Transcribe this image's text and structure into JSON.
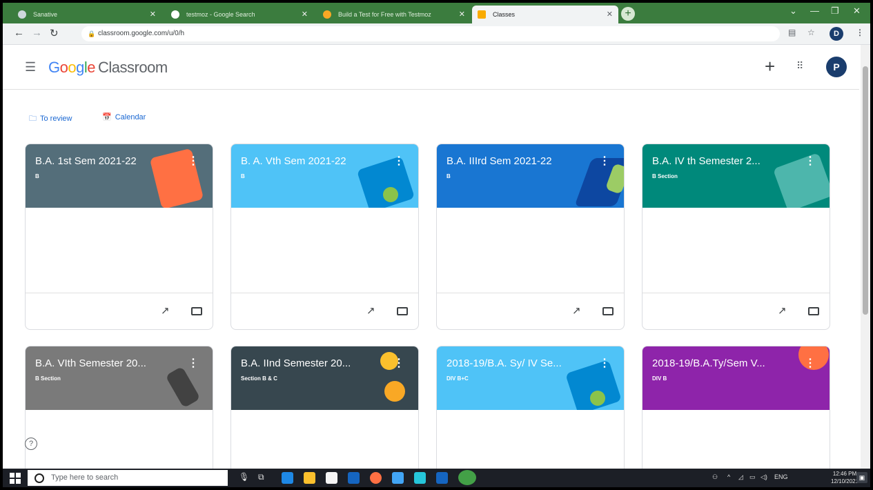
{
  "browser": {
    "tabs": [
      {
        "title": "Sanative",
        "active": false
      },
      {
        "title": "testmoz - Google Search",
        "active": false
      },
      {
        "title": "Build a Test for Free with Testmoz",
        "active": false
      },
      {
        "title": "Classes",
        "active": true
      }
    ],
    "new_tab": "+",
    "url": "classroom.google.com/u/0/h",
    "profile_letter": "D"
  },
  "header": {
    "logo_letters": [
      "G",
      "o",
      "o",
      "g",
      "l",
      "e"
    ],
    "product": "Classroom",
    "avatar_letter": "P"
  },
  "links": {
    "to_review": "To review",
    "calendar": "Calendar"
  },
  "classes": [
    {
      "title": "B.A. 1st Sem 2021-22",
      "section": "B",
      "color": "#546e7a"
    },
    {
      "title": "B. A. Vth Sem 2021-22",
      "section": "B",
      "color": "#4fc3f7"
    },
    {
      "title": "B.A. IIIrd Sem 2021-22",
      "section": "B",
      "color": "#1976d2"
    },
    {
      "title": "B.A. IV th Semester 2...",
      "section": "B Section",
      "color": "#00897b"
    },
    {
      "title": "B.A. VIth Semester 20...",
      "section": "B Section",
      "color": "#7a7a7a"
    },
    {
      "title": "B.A. IInd Semester 20...",
      "section": "Section B & C",
      "color": "#37474f"
    },
    {
      "title": "2018-19/B.A. Sy/ IV Se...",
      "section": "DIV B+C",
      "color": "#4fc3f7"
    },
    {
      "title": "2018-19/B.A.Ty/Sem V...",
      "section": "DIV B",
      "color": "#8e24aa"
    }
  ],
  "taskbar": {
    "search_placeholder": "Type here to search",
    "lang": "ENG",
    "time": "12:46 PM",
    "date": "12/10/2021"
  },
  "colors": {
    "tabstrip": "#3b7c3e",
    "link": "#1967d2",
    "taskbar": "#1c1f26"
  }
}
